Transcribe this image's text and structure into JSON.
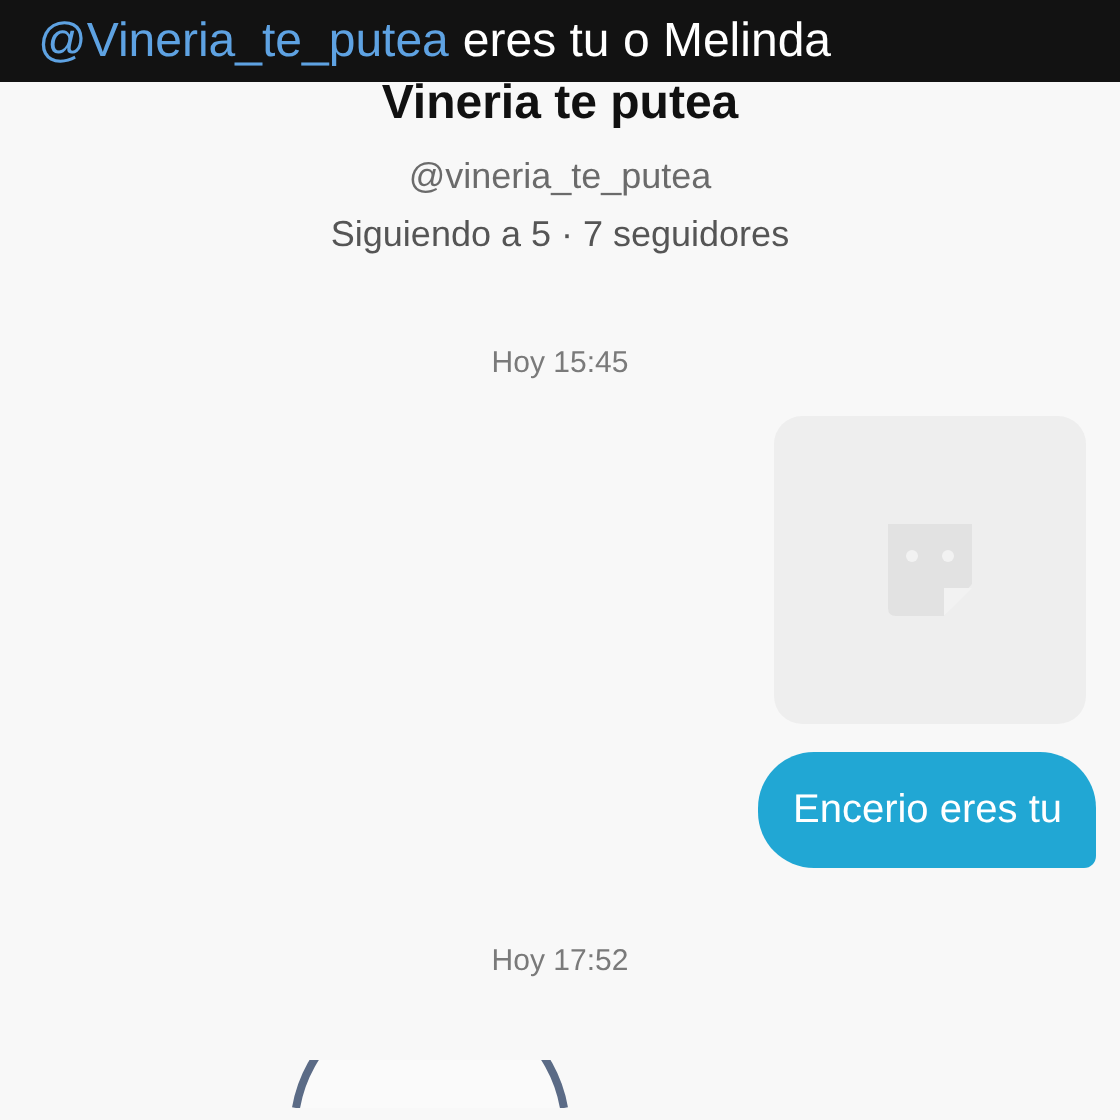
{
  "caption": {
    "mention": "@Vineria_te_putea",
    "text": "eres tu o Melinda"
  },
  "profile": {
    "name": "Vineria te putea",
    "handle": "@vineria_te_putea",
    "stats": "Siguiendo a 5 · 7 seguidores"
  },
  "messages": [
    {
      "kind": "timestamp",
      "text": "Hoy 15:45"
    },
    {
      "kind": "sticker"
    },
    {
      "kind": "text",
      "text": "Encerio eres tu"
    },
    {
      "kind": "timestamp",
      "text": "Hoy 17:52"
    },
    {
      "kind": "avatar"
    }
  ]
}
